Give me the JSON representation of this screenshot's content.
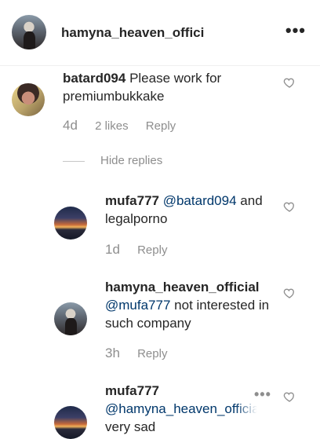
{
  "header": {
    "username": "hamyna_heaven_officia",
    "more_label": "•••"
  },
  "comments": [
    {
      "user": "batard094",
      "text": "Please work for premiumbukkake",
      "time": "4d",
      "likes": "2 likes",
      "reply_label": "Reply"
    }
  ],
  "hide_replies_label": "Hide replies",
  "replies": [
    {
      "user": "mufa777",
      "mention": "@batard094",
      "text": "and legalporno",
      "time": "1d",
      "reply_label": "Reply"
    },
    {
      "user": "hamyna_heaven_official",
      "mention": "@mufa777",
      "text": "not interested in such company",
      "time": "3h",
      "reply_label": "Reply"
    },
    {
      "user": "mufa777",
      "mention": "@hamyna_heaven_official",
      "text": "very sad",
      "more_label": "•••"
    }
  ],
  "icons": {
    "heart": "heart-outline-icon",
    "more": "more-options-icon"
  },
  "colors": {
    "text": "#262626",
    "meta": "#8e8e8e",
    "mention": "#00376b"
  }
}
